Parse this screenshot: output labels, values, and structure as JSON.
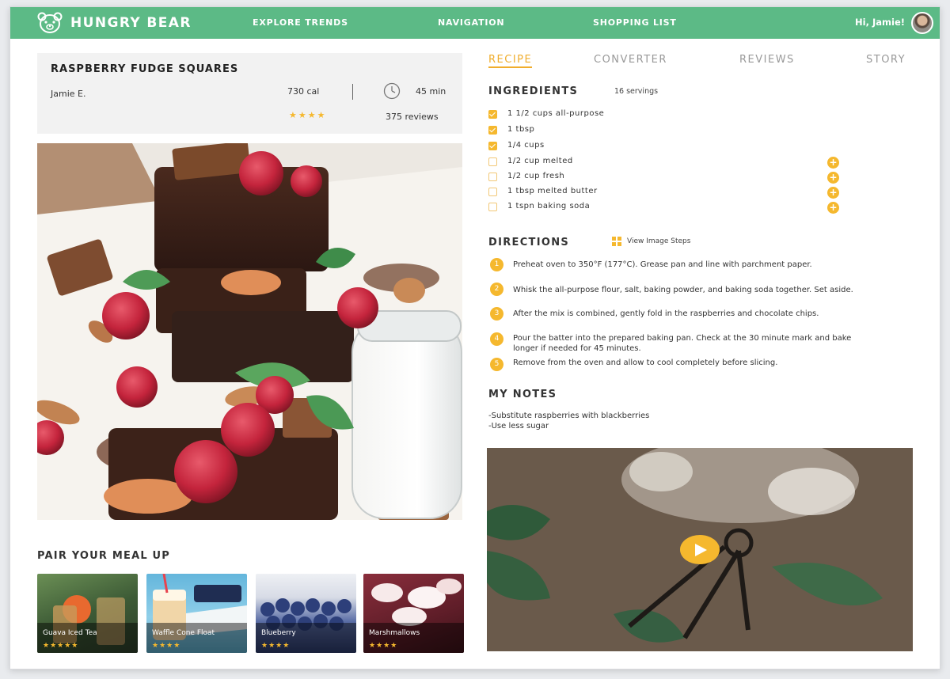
{
  "app": {
    "brand": "HUNGRY BEAR",
    "greeting": "Hi, Jamie!"
  },
  "nav": {
    "items": [
      "EXPLORE TRENDS",
      "NAVIGATION",
      "SHOPPING LIST"
    ]
  },
  "recipe": {
    "title": "RASPBERRY FUDGE SQUARES",
    "author": "Jamie E.",
    "calories": "730 cal",
    "time": "45 min",
    "rating_stars": "★★★★",
    "rating": 4,
    "reviews": "375 reviews"
  },
  "pairing": {
    "title": "PAIR YOUR MEAL UP",
    "items": [
      {
        "label": "Guava Iced Tea",
        "stars": "★★★★★",
        "rating": 5
      },
      {
        "label": "Waffle Cone Float",
        "stars": "★★★★",
        "rating": 4
      },
      {
        "label": "Blueberry",
        "stars": "★★★★",
        "rating": 4
      },
      {
        "label": "Marshmallows",
        "stars": "★★★★",
        "rating": 4
      }
    ]
  },
  "tabs": [
    "RECIPE",
    "CONVERTER",
    "REVIEWS",
    "STORY"
  ],
  "ingredients": {
    "title": "INGREDIENTS",
    "servings": "16 servings",
    "items": [
      {
        "text": "1 1/2 cups all-purpose",
        "checked": true
      },
      {
        "text": "1 tbsp",
        "checked": true
      },
      {
        "text": "1/4 cups",
        "checked": true
      },
      {
        "text": "1/2 cup melted",
        "checked": false
      },
      {
        "text": "1/2 cup fresh",
        "checked": false
      },
      {
        "text": "1 tbsp melted butter",
        "checked": false
      },
      {
        "text": "1 tspn baking soda",
        "checked": false
      }
    ],
    "add_symbol": "+"
  },
  "directions": {
    "title": "DIRECTIONS",
    "view_steps": "View Image Steps",
    "steps": [
      {
        "num": "1",
        "text": "Preheat oven to 350°F (177°C). Grease pan and line with parchment paper."
      },
      {
        "num": "2",
        "text": "Whisk the all-purpose flour, salt, baking powder, and baking soda together. Set aside."
      },
      {
        "num": "3",
        "text": "After the mix is combined, gently fold in the raspberries and chocolate chips."
      },
      {
        "num": "4",
        "text": "Pour the batter into the prepared baking pan. Check at the 30 minute mark and bake longer if needed for 45 minutes."
      },
      {
        "num": "5",
        "text": "Remove from the oven and allow to cool completely before slicing."
      }
    ]
  },
  "notes": {
    "title": "MY NOTES",
    "lines": [
      "-Substitute raspberries with blackberries",
      "-Use less sugar"
    ]
  },
  "icons": {
    "brand": "bear-logo-icon",
    "clock": "clock-icon",
    "grid": "grid-icon",
    "play": "play-icon"
  },
  "colors": {
    "brand_green": "#5cba86",
    "accent": "#f5b82e",
    "tab_active": "#f0ad2c"
  }
}
